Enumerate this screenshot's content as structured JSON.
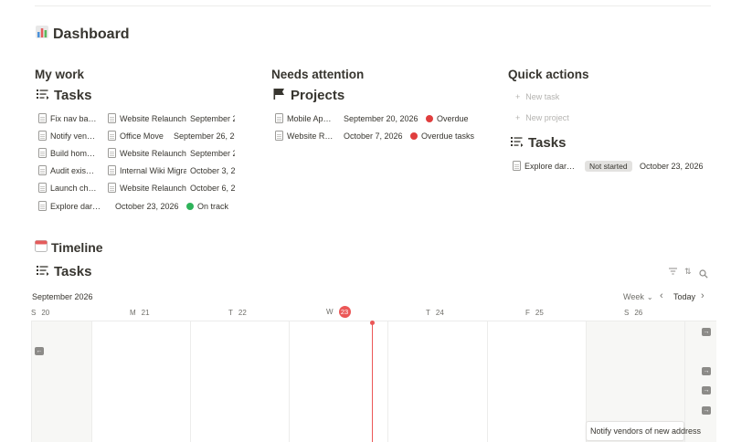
{
  "page": {
    "title_icon": "bar-chart-icon",
    "title": "Dashboard"
  },
  "my_work": {
    "heading": "My work",
    "db_title": "Tasks",
    "rows": [
      {
        "name": "Fix nav ba…",
        "project": "Website Relaunch",
        "date": "September 2…"
      },
      {
        "name": "Notify ven…",
        "project": "Office Move",
        "date": "September 26, 20…"
      },
      {
        "name": "Build hom…",
        "project": "Website Relaunch",
        "date": "September 2…"
      },
      {
        "name": "Audit exis…",
        "project": "Internal Wiki Migra…",
        "date": "October 3, 2…"
      },
      {
        "name": "Launch ch…",
        "project": "Website Relaunch",
        "date": "October 6, 2…"
      },
      {
        "name": "Explore dar…",
        "project": "",
        "date": "October 23, 2026",
        "status": "On track"
      }
    ]
  },
  "needs_attention": {
    "heading": "Needs attention",
    "db_title": "Projects",
    "rows": [
      {
        "name": "Mobile Ap…",
        "date": "September 20, 2026",
        "status": "Overdue"
      },
      {
        "name": "Website R…",
        "date": "October 7, 2026",
        "status": "Overdue tasks"
      }
    ]
  },
  "quick_actions": {
    "heading": "Quick actions",
    "new_task": "New task",
    "new_project": "New project",
    "db_title": "Tasks",
    "row": {
      "name": "Explore dar…",
      "status": "Not started",
      "date": "October 23, 2026"
    }
  },
  "timeline": {
    "heading": "Timeline",
    "db_title": "Tasks",
    "month": "September 2026",
    "range": "Week",
    "today_label": "Today",
    "days": [
      {
        "letter": "S",
        "num": "20"
      },
      {
        "letter": "M",
        "num": "21"
      },
      {
        "letter": "T",
        "num": "22"
      },
      {
        "letter": "W",
        "num": "23"
      },
      {
        "letter": "T",
        "num": "24"
      },
      {
        "letter": "F",
        "num": "25"
      },
      {
        "letter": "S",
        "num": "26"
      }
    ],
    "bar_label": "Notify vendors of new address"
  },
  "colors": {
    "green": "#2eb35a",
    "red": "#e03e3e",
    "today": "#eb5757"
  }
}
